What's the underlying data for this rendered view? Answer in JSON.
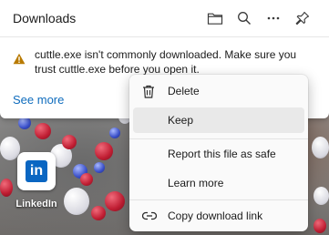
{
  "panel": {
    "title": "Downloads",
    "header_icons": [
      "folder-icon",
      "search-icon",
      "more-icon",
      "pin-icon"
    ],
    "warning": {
      "icon": "warning-icon",
      "message": "cuttle.exe isn't commonly downloaded. Make sure you trust cuttle.exe before you open it."
    },
    "see_more_label": "See more"
  },
  "context_menu": {
    "items": [
      {
        "label": "Delete",
        "icon": "trash-icon"
      },
      {
        "label": "Keep",
        "icon": ""
      },
      {
        "label": "Report this file as safe",
        "icon": ""
      },
      {
        "label": "Learn more",
        "icon": ""
      },
      {
        "label": "Copy download link",
        "icon": "link-icon"
      }
    ]
  },
  "desktop": {
    "shortcut_label": "LinkedIn",
    "shortcut_logo_text": "in"
  },
  "colors": {
    "accent": "#0f6cbd",
    "warning": "#b87a00",
    "linkedin": "#0a66c2"
  }
}
